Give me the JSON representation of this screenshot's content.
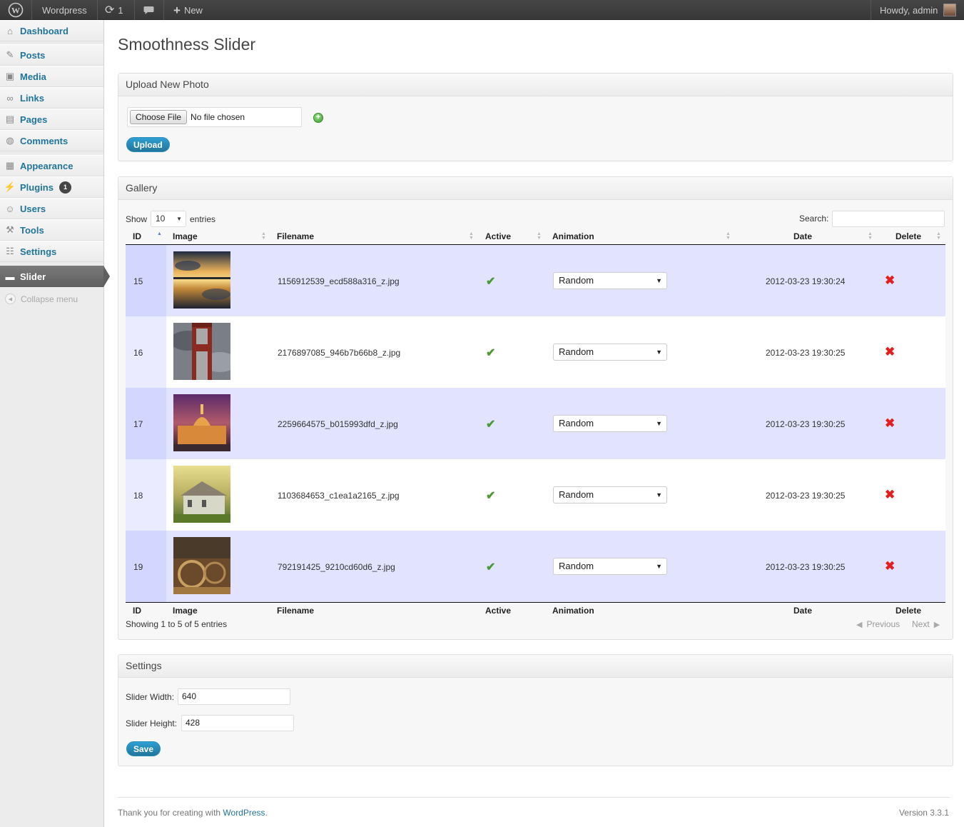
{
  "adminbar": {
    "wp_icon": "wordpress-logo-icon",
    "site": "Wordpress",
    "updates": "1",
    "comments_icon": "comment-bubble-icon",
    "new_label": "New",
    "howdy": "Howdy, admin"
  },
  "sidebar": {
    "items": [
      {
        "label": "Dashboard",
        "icon": "dashboard-icon"
      },
      {
        "label": "Posts",
        "icon": "pin-icon"
      },
      {
        "label": "Media",
        "icon": "media-icon"
      },
      {
        "label": "Links",
        "icon": "link-icon"
      },
      {
        "label": "Pages",
        "icon": "page-icon"
      },
      {
        "label": "Comments",
        "icon": "comment-icon"
      },
      {
        "label": "Appearance",
        "icon": "appearance-icon"
      },
      {
        "label": "Plugins",
        "icon": "plug-icon",
        "badge": "1"
      },
      {
        "label": "Users",
        "icon": "users-icon"
      },
      {
        "label": "Tools",
        "icon": "tools-icon"
      },
      {
        "label": "Settings",
        "icon": "settings-icon"
      },
      {
        "label": "Slider",
        "icon": "slider-icon"
      }
    ],
    "collapse": "Collapse menu"
  },
  "page_title": "Smoothness Slider",
  "upload": {
    "header": "Upload New Photo",
    "choose": "Choose File",
    "no_file": "No file chosen",
    "button": "Upload"
  },
  "gallery": {
    "header": "Gallery",
    "show": "Show",
    "entries_value": "10",
    "entries": "entries",
    "search": "Search:",
    "columns": {
      "id": "ID",
      "image": "Image",
      "filename": "Filename",
      "active": "Active",
      "animation": "Animation",
      "date": "Date",
      "delete": "Delete"
    },
    "rows": [
      {
        "id": "15",
        "filename": "1156912539_ecd588a316_z.jpg",
        "animation": "Random",
        "date": "2012-03-23 19:30:24"
      },
      {
        "id": "16",
        "filename": "2176897085_946b7b66b8_z.jpg",
        "animation": "Random",
        "date": "2012-03-23 19:30:25"
      },
      {
        "id": "17",
        "filename": "2259664575_b015993dfd_z.jpg",
        "animation": "Random",
        "date": "2012-03-23 19:30:25"
      },
      {
        "id": "18",
        "filename": "1103684653_c1ea1a2165_z.jpg",
        "animation": "Random",
        "date": "2012-03-23 19:30:25"
      },
      {
        "id": "19",
        "filename": "792191425_9210cd60d6_z.jpg",
        "animation": "Random",
        "date": "2012-03-23 19:30:25"
      }
    ],
    "info": "Showing 1 to 5 of 5 entries",
    "previous": "Previous",
    "next": "Next"
  },
  "settings": {
    "header": "Settings",
    "width_label": "Slider Width:",
    "width": "640",
    "height_label": "Slider Height:",
    "height": "428",
    "button": "Save"
  },
  "footer": {
    "thanks": "Thank you for creating with ",
    "wp_link": "WordPress",
    "period": ".",
    "version": "Version 3.3.1"
  }
}
